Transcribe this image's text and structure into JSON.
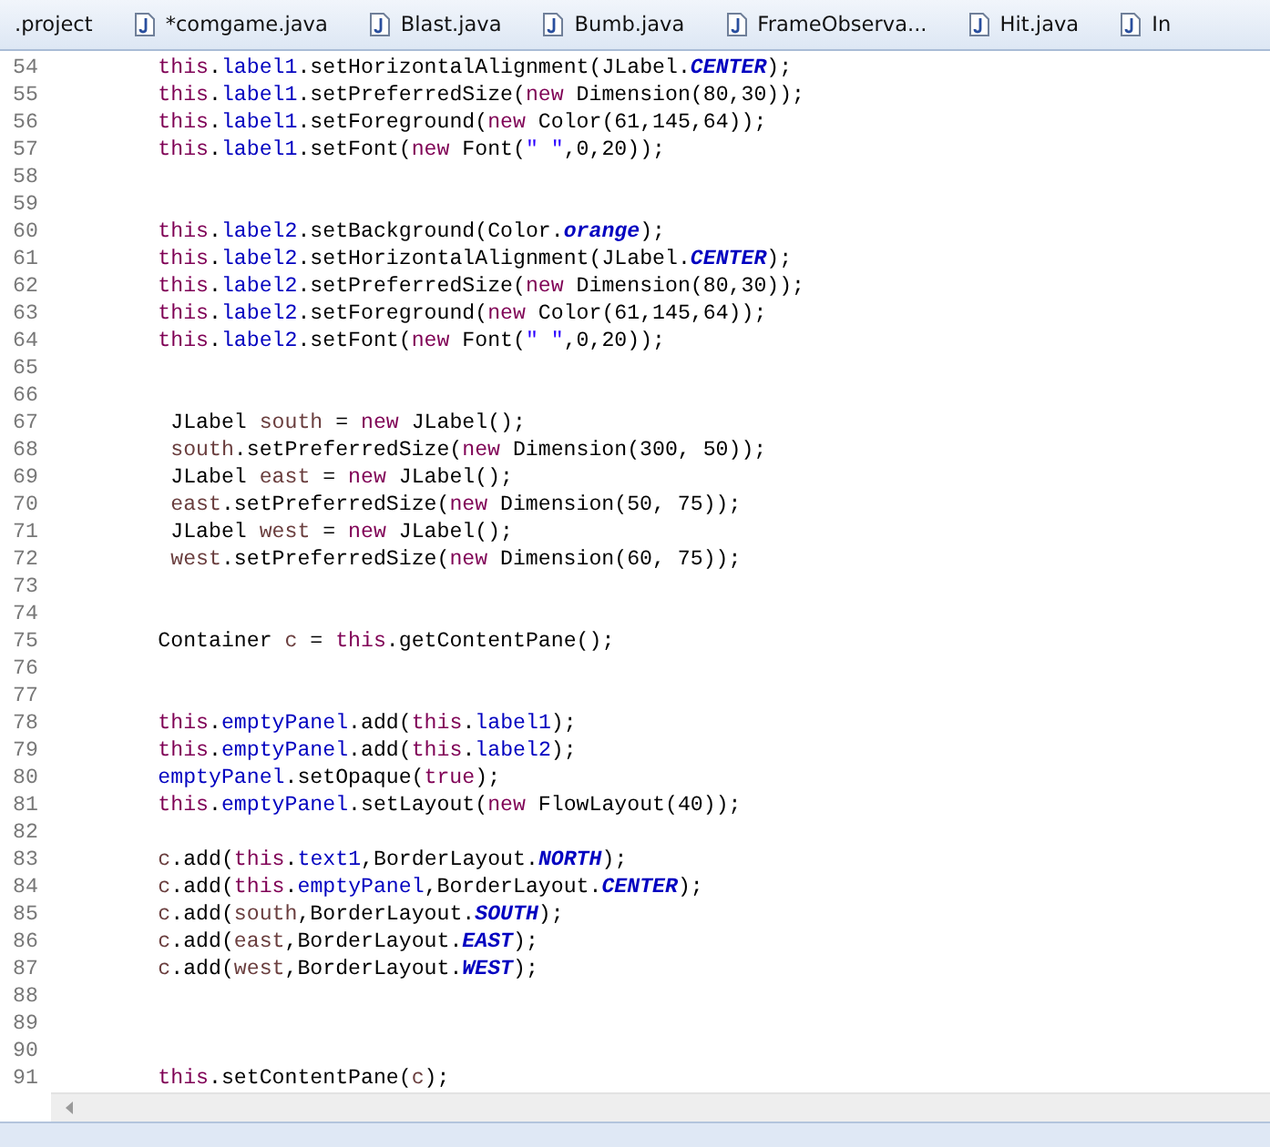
{
  "tabs": [
    {
      "label": ".project",
      "icon": false,
      "selected": false
    },
    {
      "label": "*comgame.java",
      "icon": true,
      "selected": false
    },
    {
      "label": "Blast.java",
      "icon": true,
      "selected": false
    },
    {
      "label": "Bumb.java",
      "icon": true,
      "selected": false
    },
    {
      "label": "FrameObserva...",
      "icon": true,
      "selected": false
    },
    {
      "label": "Hit.java",
      "icon": true,
      "selected": false
    },
    {
      "label": "In",
      "icon": true,
      "selected": false
    }
  ],
  "editor": {
    "lines": [
      {
        "number": "54",
        "tokens": [
          {
            "kind": "keyword",
            "text": "        this"
          },
          {
            "kind": "plain",
            "text": "."
          },
          {
            "kind": "field",
            "text": "label1"
          },
          {
            "kind": "plain",
            "text": ".setHorizontalAlignment(JLabel."
          },
          {
            "kind": "constant",
            "text": "CENTER"
          },
          {
            "kind": "plain",
            "text": ");"
          }
        ]
      },
      {
        "number": "55",
        "tokens": [
          {
            "kind": "keyword",
            "text": "        this"
          },
          {
            "kind": "plain",
            "text": "."
          },
          {
            "kind": "field",
            "text": "label1"
          },
          {
            "kind": "plain",
            "text": ".setPreferredSize("
          },
          {
            "kind": "keyword",
            "text": "new"
          },
          {
            "kind": "plain",
            "text": " Dimension(80,30));"
          }
        ]
      },
      {
        "number": "56",
        "tokens": [
          {
            "kind": "keyword",
            "text": "        this"
          },
          {
            "kind": "plain",
            "text": "."
          },
          {
            "kind": "field",
            "text": "label1"
          },
          {
            "kind": "plain",
            "text": ".setForeground("
          },
          {
            "kind": "keyword",
            "text": "new"
          },
          {
            "kind": "plain",
            "text": " Color(61,145,64));"
          }
        ]
      },
      {
        "number": "57",
        "tokens": [
          {
            "kind": "keyword",
            "text": "        this"
          },
          {
            "kind": "plain",
            "text": "."
          },
          {
            "kind": "field",
            "text": "label1"
          },
          {
            "kind": "plain",
            "text": ".setFont("
          },
          {
            "kind": "keyword",
            "text": "new"
          },
          {
            "kind": "plain",
            "text": " Font("
          },
          {
            "kind": "string",
            "text": "\" \""
          },
          {
            "kind": "plain",
            "text": ",0,20));"
          }
        ]
      },
      {
        "number": "58"
      },
      {
        "number": "59"
      },
      {
        "number": "60",
        "tokens": [
          {
            "kind": "keyword",
            "text": "        this"
          },
          {
            "kind": "plain",
            "text": "."
          },
          {
            "kind": "field",
            "text": "label2"
          },
          {
            "kind": "plain",
            "text": ".setBackground(Color."
          },
          {
            "kind": "constant",
            "text": "orange"
          },
          {
            "kind": "plain",
            "text": ");"
          }
        ]
      },
      {
        "number": "61",
        "tokens": [
          {
            "kind": "keyword",
            "text": "        this"
          },
          {
            "kind": "plain",
            "text": "."
          },
          {
            "kind": "field",
            "text": "label2"
          },
          {
            "kind": "plain",
            "text": ".setHorizontalAlignment(JLabel."
          },
          {
            "kind": "constant",
            "text": "CENTER"
          },
          {
            "kind": "plain",
            "text": ");"
          }
        ]
      },
      {
        "number": "62",
        "tokens": [
          {
            "kind": "keyword",
            "text": "        this"
          },
          {
            "kind": "plain",
            "text": "."
          },
          {
            "kind": "field",
            "text": "label2"
          },
          {
            "kind": "plain",
            "text": ".setPreferredSize("
          },
          {
            "kind": "keyword",
            "text": "new"
          },
          {
            "kind": "plain",
            "text": " Dimension(80,30));"
          }
        ]
      },
      {
        "number": "63",
        "tokens": [
          {
            "kind": "keyword",
            "text": "        this"
          },
          {
            "kind": "plain",
            "text": "."
          },
          {
            "kind": "field",
            "text": "label2"
          },
          {
            "kind": "plain",
            "text": ".setForeground("
          },
          {
            "kind": "keyword",
            "text": "new"
          },
          {
            "kind": "plain",
            "text": " Color(61,145,64));"
          }
        ]
      },
      {
        "number": "64",
        "tokens": [
          {
            "kind": "keyword",
            "text": "        this"
          },
          {
            "kind": "plain",
            "text": "."
          },
          {
            "kind": "field",
            "text": "label2"
          },
          {
            "kind": "plain",
            "text": ".setFont("
          },
          {
            "kind": "keyword",
            "text": "new"
          },
          {
            "kind": "plain",
            "text": " Font("
          },
          {
            "kind": "string",
            "text": "\" \""
          },
          {
            "kind": "plain",
            "text": ",0,20));"
          }
        ]
      },
      {
        "number": "65"
      },
      {
        "number": "66"
      },
      {
        "number": "67",
        "tokens": [
          {
            "kind": "plain",
            "text": "         JLabel "
          },
          {
            "kind": "local",
            "text": "south"
          },
          {
            "kind": "plain",
            "text": " = "
          },
          {
            "kind": "keyword",
            "text": "new"
          },
          {
            "kind": "plain",
            "text": " JLabel();"
          }
        ]
      },
      {
        "number": "68",
        "tokens": [
          {
            "kind": "local",
            "text": "         south"
          },
          {
            "kind": "plain",
            "text": ".setPreferredSize("
          },
          {
            "kind": "keyword",
            "text": "new"
          },
          {
            "kind": "plain",
            "text": " Dimension(300, 50));"
          }
        ]
      },
      {
        "number": "69",
        "tokens": [
          {
            "kind": "plain",
            "text": "         JLabel "
          },
          {
            "kind": "local",
            "text": "east"
          },
          {
            "kind": "plain",
            "text": " = "
          },
          {
            "kind": "keyword",
            "text": "new"
          },
          {
            "kind": "plain",
            "text": " JLabel();"
          }
        ]
      },
      {
        "number": "70",
        "tokens": [
          {
            "kind": "local",
            "text": "         east"
          },
          {
            "kind": "plain",
            "text": ".setPreferredSize("
          },
          {
            "kind": "keyword",
            "text": "new"
          },
          {
            "kind": "plain",
            "text": " Dimension(50, 75));"
          }
        ]
      },
      {
        "number": "71",
        "tokens": [
          {
            "kind": "plain",
            "text": "         JLabel "
          },
          {
            "kind": "local",
            "text": "west"
          },
          {
            "kind": "plain",
            "text": " = "
          },
          {
            "kind": "keyword",
            "text": "new"
          },
          {
            "kind": "plain",
            "text": " JLabel();"
          }
        ]
      },
      {
        "number": "72",
        "tokens": [
          {
            "kind": "local",
            "text": "         west"
          },
          {
            "kind": "plain",
            "text": ".setPreferredSize("
          },
          {
            "kind": "keyword",
            "text": "new"
          },
          {
            "kind": "plain",
            "text": " Dimension(60, 75));"
          }
        ]
      },
      {
        "number": "73"
      },
      {
        "number": "74"
      },
      {
        "number": "75",
        "tokens": [
          {
            "kind": "plain",
            "text": "        Container "
          },
          {
            "kind": "local",
            "text": "c"
          },
          {
            "kind": "plain",
            "text": " = "
          },
          {
            "kind": "keyword",
            "text": "this"
          },
          {
            "kind": "plain",
            "text": ".getContentPane();"
          }
        ]
      },
      {
        "number": "76"
      },
      {
        "number": "77"
      },
      {
        "number": "78",
        "tokens": [
          {
            "kind": "keyword",
            "text": "        this"
          },
          {
            "kind": "plain",
            "text": "."
          },
          {
            "kind": "field",
            "text": "emptyPanel"
          },
          {
            "kind": "plain",
            "text": ".add("
          },
          {
            "kind": "keyword",
            "text": "this"
          },
          {
            "kind": "plain",
            "text": "."
          },
          {
            "kind": "field",
            "text": "label1"
          },
          {
            "kind": "plain",
            "text": ");"
          }
        ]
      },
      {
        "number": "79",
        "tokens": [
          {
            "kind": "keyword",
            "text": "        this"
          },
          {
            "kind": "plain",
            "text": "."
          },
          {
            "kind": "field",
            "text": "emptyPanel"
          },
          {
            "kind": "plain",
            "text": ".add("
          },
          {
            "kind": "keyword",
            "text": "this"
          },
          {
            "kind": "plain",
            "text": "."
          },
          {
            "kind": "field",
            "text": "label2"
          },
          {
            "kind": "plain",
            "text": ");"
          }
        ]
      },
      {
        "number": "80",
        "tokens": [
          {
            "kind": "field",
            "text": "        emptyPanel"
          },
          {
            "kind": "plain",
            "text": ".setOpaque("
          },
          {
            "kind": "keyword",
            "text": "true"
          },
          {
            "kind": "plain",
            "text": ");"
          }
        ]
      },
      {
        "number": "81",
        "tokens": [
          {
            "kind": "keyword",
            "text": "        this"
          },
          {
            "kind": "plain",
            "text": "."
          },
          {
            "kind": "field",
            "text": "emptyPanel"
          },
          {
            "kind": "plain",
            "text": ".setLayout("
          },
          {
            "kind": "keyword",
            "text": "new"
          },
          {
            "kind": "plain",
            "text": " FlowLayout(40));"
          }
        ]
      },
      {
        "number": "82"
      },
      {
        "number": "83",
        "tokens": [
          {
            "kind": "local",
            "text": "        c"
          },
          {
            "kind": "plain",
            "text": ".add("
          },
          {
            "kind": "keyword",
            "text": "this"
          },
          {
            "kind": "plain",
            "text": "."
          },
          {
            "kind": "field",
            "text": "text1"
          },
          {
            "kind": "plain",
            "text": ",BorderLayout."
          },
          {
            "kind": "constant",
            "text": "NORTH"
          },
          {
            "kind": "plain",
            "text": ");"
          }
        ]
      },
      {
        "number": "84",
        "tokens": [
          {
            "kind": "local",
            "text": "        c"
          },
          {
            "kind": "plain",
            "text": ".add("
          },
          {
            "kind": "keyword",
            "text": "this"
          },
          {
            "kind": "plain",
            "text": "."
          },
          {
            "kind": "field",
            "text": "emptyPanel"
          },
          {
            "kind": "plain",
            "text": ",BorderLayout."
          },
          {
            "kind": "constant",
            "text": "CENTER"
          },
          {
            "kind": "plain",
            "text": ");"
          }
        ]
      },
      {
        "number": "85",
        "tokens": [
          {
            "kind": "local",
            "text": "        c"
          },
          {
            "kind": "plain",
            "text": ".add("
          },
          {
            "kind": "local",
            "text": "south"
          },
          {
            "kind": "plain",
            "text": ",BorderLayout."
          },
          {
            "kind": "constant",
            "text": "SOUTH"
          },
          {
            "kind": "plain",
            "text": ");"
          }
        ]
      },
      {
        "number": "86",
        "tokens": [
          {
            "kind": "local",
            "text": "        c"
          },
          {
            "kind": "plain",
            "text": ".add("
          },
          {
            "kind": "local",
            "text": "east"
          },
          {
            "kind": "plain",
            "text": ",BorderLayout."
          },
          {
            "kind": "constant",
            "text": "EAST"
          },
          {
            "kind": "plain",
            "text": ");"
          }
        ]
      },
      {
        "number": "87",
        "tokens": [
          {
            "kind": "local",
            "text": "        c"
          },
          {
            "kind": "plain",
            "text": ".add("
          },
          {
            "kind": "local",
            "text": "west"
          },
          {
            "kind": "plain",
            "text": ",BorderLayout."
          },
          {
            "kind": "constant",
            "text": "WEST"
          },
          {
            "kind": "plain",
            "text": ");"
          }
        ]
      },
      {
        "number": "88"
      },
      {
        "number": "89"
      },
      {
        "number": "90"
      },
      {
        "number": "91",
        "tokens": [
          {
            "kind": "keyword",
            "text": "        this"
          },
          {
            "kind": "plain",
            "text": ".setContentPane("
          },
          {
            "kind": "local",
            "text": "c"
          },
          {
            "kind": "plain",
            "text": ");"
          }
        ]
      }
    ]
  }
}
